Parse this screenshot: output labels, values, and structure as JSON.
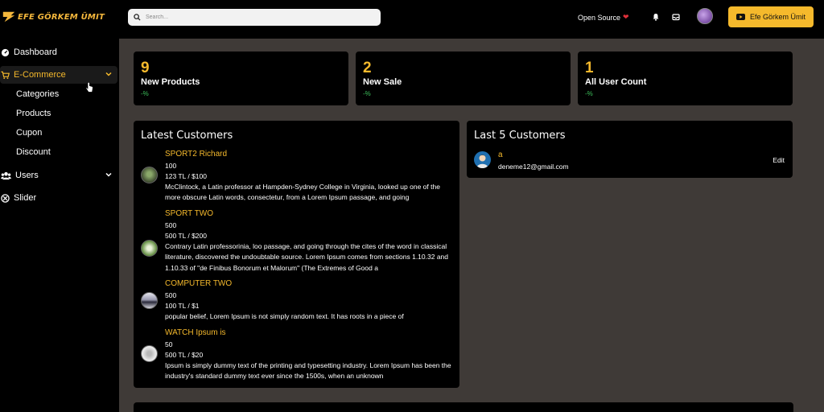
{
  "header": {
    "logo_text": "EFE GÖRKEM ÜMIT",
    "search_placeholder": "Search...",
    "open_source_label": "Open Source",
    "youtube_button_label": "Efe Görkem Ümit"
  },
  "sidebar": {
    "items": [
      {
        "label": "Dashboard"
      },
      {
        "label": "E-Commerce"
      },
      {
        "label": "Users"
      },
      {
        "label": "Slider"
      }
    ],
    "ecommerce_sub": [
      "Categories",
      "Products",
      "Cupon",
      "Discount"
    ]
  },
  "stats": [
    {
      "number": "9",
      "label": "New Products",
      "change": "-%"
    },
    {
      "number": "2",
      "label": "New Sale",
      "change": "-%"
    },
    {
      "number": "1",
      "label": "All User Count",
      "change": "-%"
    }
  ],
  "latest": {
    "title": "Latest Customers",
    "products": [
      {
        "name": "SPORT2 Richard",
        "stock": "100",
        "price": "123 TL / $100",
        "desc": "McClintock, a Latin professor at Hampden-Sydney College in Virginia, looked up one of the more obscure Latin words, consectetur, from a Lorem Ipsum passage, and going"
      },
      {
        "name": "SPORT TWO",
        "stock": "500",
        "price": "500 TL / $200",
        "desc": "Contrary Latin professorinia, loo passage, and going through the cites of the word in classical literature, discovered the undoubtable source. Lorem Ipsum comes from sections 1.10.32 and 1.10.33 of \"de Finibus Bonorum et Malorum\" (The Extremes of Good a"
      },
      {
        "name": "COMPUTER TWO",
        "stock": "500",
        "price": "100 TL / $1",
        "desc": "popular belief, Lorem Ipsum is not simply random text. It has roots in a piece of"
      },
      {
        "name": "WATCH Ipsum is",
        "stock": "50",
        "price": "500 TL / $20",
        "desc": "Ipsum is simply dummy text of the printing and typesetting industry. Lorem Ipsum has been the industry's standard dummy text ever since the 1500s, when an unknown"
      }
    ]
  },
  "last5": {
    "title": "Last 5 Customers",
    "customers": [
      {
        "name": "a",
        "email": "deneme12@gmail.com",
        "action": "Edit"
      }
    ]
  },
  "colors": {
    "accent": "#f5b92c",
    "background": "#3f3a37",
    "panel": "#000000",
    "positive": "#3cbf5a"
  }
}
